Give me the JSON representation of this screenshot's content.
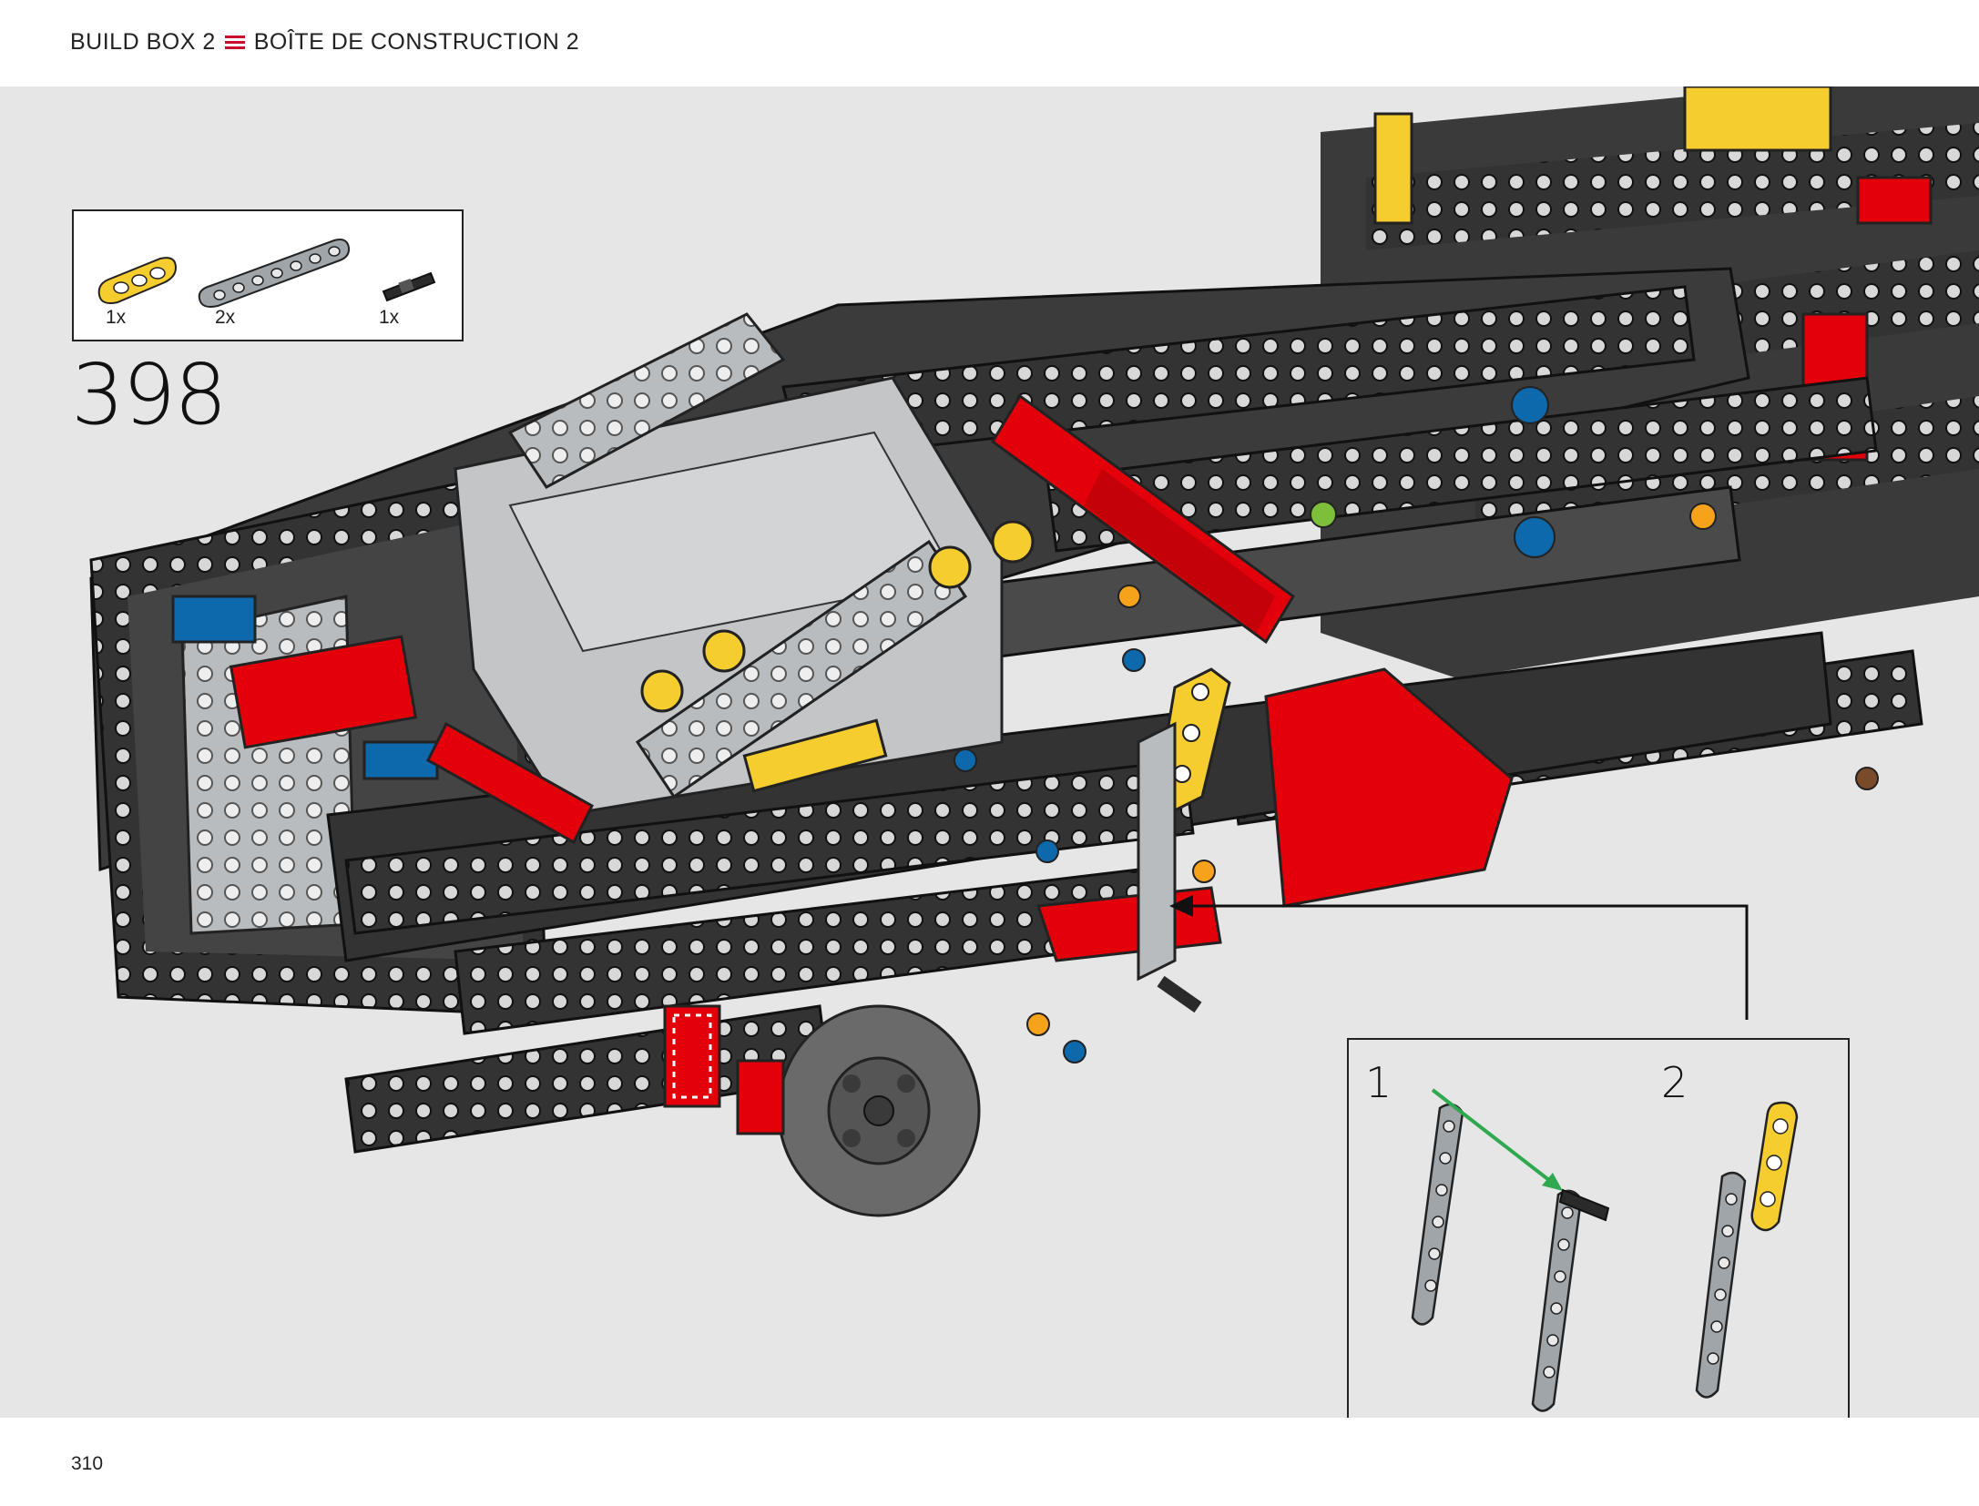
{
  "header": {
    "build_box_en": "BUILD BOX 2",
    "separator_icon": "triple-bar-icon",
    "build_box_fr": "BOÎTE DE CONSTRUCTION 2"
  },
  "parts_list": [
    {
      "qty": "1x",
      "part": "yellow-3-hole-beam",
      "color": "#f5cd2f"
    },
    {
      "qty": "2x",
      "part": "grey-7-hole-beam",
      "color": "#a0a5a9"
    },
    {
      "qty": "1x",
      "part": "black-axle-pin",
      "color": "#2a2a2a"
    }
  ],
  "step": {
    "number": "398"
  },
  "callout": {
    "substep1": "1",
    "substep2": "2"
  },
  "page": {
    "number": "310"
  },
  "colors": {
    "accent_red": "#c8102e",
    "technic_black": "#2f2f2f",
    "technic_grey": "#a0a5a9",
    "technic_red": "#e3000b",
    "technic_yellow": "#f5cd2f",
    "technic_blue": "#0d69ab",
    "arrow_green": "#2fa84f",
    "background": "#e6e6e6"
  }
}
